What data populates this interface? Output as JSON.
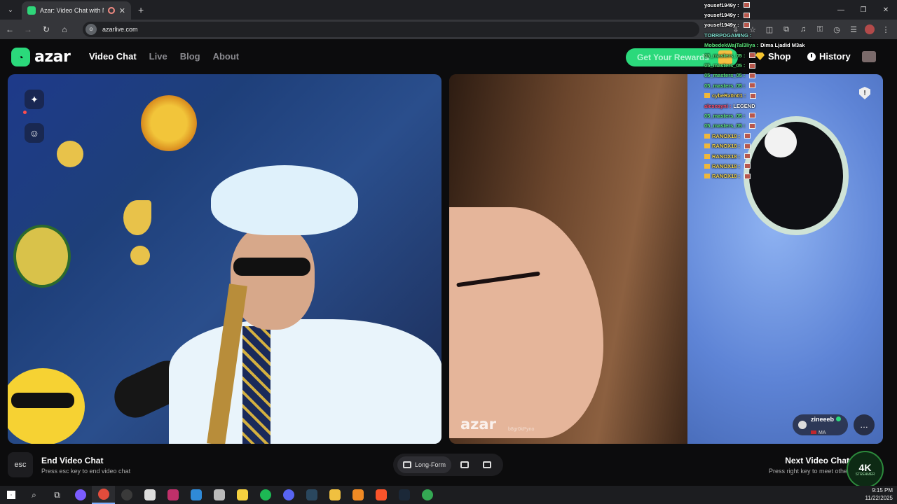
{
  "browser": {
    "tab_title": "Azar: Video Chat with New",
    "url": "azarlive.com",
    "window_controls": [
      "minimize-icon",
      "restore-icon",
      "close-icon"
    ]
  },
  "site": {
    "logo_text": "azar",
    "nav": [
      {
        "label": "Video Chat",
        "active": true
      },
      {
        "label": "Live",
        "active": false
      },
      {
        "label": "Blog",
        "active": false
      },
      {
        "label": "About",
        "active": false
      }
    ],
    "rewards_label": "Get Your Rewards",
    "shop_label": "Shop",
    "history_label": "History",
    "accent_color": "#2bd97b"
  },
  "video": {
    "watermark": "azar",
    "watermark_id": "b8gr0kPyno",
    "partner_name": "zineeeb",
    "partner_country": "MA"
  },
  "controls": {
    "esc_key": "esc",
    "end_title": "End Video Chat",
    "end_sub": "Press esc key to end video chat",
    "layout_label": "Long-Form",
    "next_title": "Next Video Chat",
    "next_sub": "Press right key to meet other"
  },
  "stream_chat": [
    {
      "name": "yousef1949y :",
      "msg": "",
      "color": "white",
      "emote": true
    },
    {
      "name": "yousef1949y :",
      "msg": "",
      "color": "white",
      "emote": true
    },
    {
      "name": "yousef1949y :",
      "msg": "",
      "color": "white",
      "emote": true
    },
    {
      "name": "TORRPOGAMING :",
      "msg": "",
      "color": "teal",
      "emote": false
    },
    {
      "name": "MobedekWajTal3liya :",
      "msg": "Dima Ljadid M3ak",
      "color": "green",
      "emote": false
    },
    {
      "name": "05_masters_05 :",
      "msg": "",
      "color": "green",
      "emote": true
    },
    {
      "name": "05_masters_05 :",
      "msg": "",
      "color": "green",
      "emote": true
    },
    {
      "name": "05_masters_05 :",
      "msg": "",
      "color": "green",
      "emote": true
    },
    {
      "name": "05_masters_05 :",
      "msg": "",
      "color": "green",
      "emote": true
    },
    {
      "name": "cybeRx0n01 :",
      "msg": "",
      "color": "yellow",
      "emote": true
    },
    {
      "name": "aleseayni :",
      "msg": "LEGEND",
      "color": "red",
      "emote": false
    },
    {
      "name": "05_masters_05 :",
      "msg": "",
      "color": "green",
      "emote": true
    },
    {
      "name": "05_masters_05 :",
      "msg": "",
      "color": "green",
      "emote": true
    },
    {
      "name": "RANOX18 :",
      "msg": "",
      "color": "yellow",
      "emote": true
    },
    {
      "name": "RANOX18 :",
      "msg": "",
      "color": "yellow",
      "emote": true
    },
    {
      "name": "RANOX18 :",
      "msg": "",
      "color": "yellow",
      "emote": true
    },
    {
      "name": "RANOX18 :",
      "msg": "",
      "color": "yellow",
      "emote": true
    },
    {
      "name": "RANOX18 :",
      "msg": "",
      "color": "yellow",
      "emote": true
    }
  ],
  "streamer_badge": {
    "big": "4K",
    "small": "STREAMER"
  },
  "taskbar": {
    "time": "9:15 PM",
    "date": "11/22/2025",
    "apps": [
      {
        "name": "search-icon",
        "color": "#1c1d20"
      },
      {
        "name": "task-view-icon",
        "color": "#1c1d20"
      },
      {
        "name": "cortana-icon",
        "color": "#7b5cff"
      },
      {
        "name": "chrome-icon",
        "color": "#e34c3c"
      },
      {
        "name": "obs-icon",
        "color": "#3a3a3a"
      },
      {
        "name": "game-icon",
        "color": "#ddd"
      },
      {
        "name": "vegas-icon",
        "color": "#c0306a"
      },
      {
        "name": "mail-icon",
        "color": "#2f8ad8"
      },
      {
        "name": "app-icon",
        "color": "#bbb"
      },
      {
        "name": "notes-icon",
        "color": "#f4d03f"
      },
      {
        "name": "spotify-icon",
        "color": "#1db954"
      },
      {
        "name": "discord-icon",
        "color": "#5865f2"
      },
      {
        "name": "steam-icon",
        "color": "#2a475e"
      },
      {
        "name": "explorer-icon",
        "color": "#f0c040"
      },
      {
        "name": "vlc-icon",
        "color": "#f08a24"
      },
      {
        "name": "brave-icon",
        "color": "#fb542b"
      },
      {
        "name": "steam2-icon",
        "color": "#1b2838"
      },
      {
        "name": "chrome2-icon",
        "color": "#34a853"
      }
    ]
  }
}
